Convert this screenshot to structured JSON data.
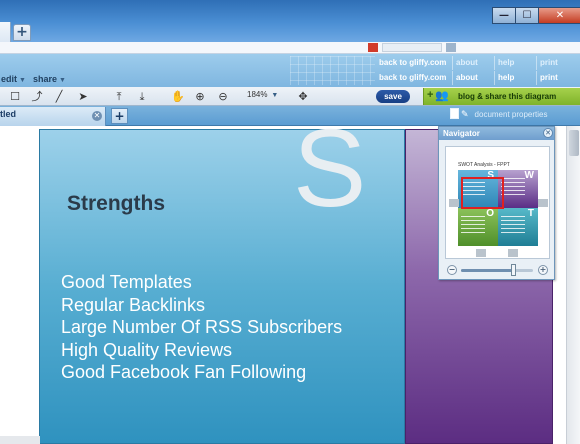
{
  "browser": {
    "new_tab": "+",
    "window_controls": {
      "minimize": "—",
      "maximize": "☐",
      "close": "✕"
    }
  },
  "header": {
    "menu": [
      {
        "label": "edit"
      },
      {
        "label": "share"
      }
    ],
    "links_top": [
      "back to gliffy.com",
      "about",
      "help",
      "print"
    ],
    "links_bottom": [
      "back to gliffy.com",
      "about",
      "help",
      "print"
    ]
  },
  "toolbar": {
    "tools": [
      "select-icon",
      "connector-icon",
      "line-icon",
      "pointer-icon",
      "bring-front-icon",
      "send-back-icon",
      "hand-icon",
      "zoom-in-icon",
      "zoom-out-icon",
      "fit-icon"
    ],
    "zoom_level": "184%",
    "save_label": "save",
    "blog_share_label": "blog & share this diagram",
    "blog_share_icon": "add-people-icon",
    "blog_accent": "#8dbf37"
  },
  "tabs": {
    "current": "tled",
    "add": "+",
    "document_properties": "document properties"
  },
  "diagram": {
    "strengths_letter": "S",
    "strengths_heading": "Strengths",
    "strengths_items": [
      "Good Templates",
      "Regular Backlinks",
      "Large Number Of RSS Subscribers",
      "High Quality Reviews",
      "Good Facebook Fan Following"
    ],
    "strengths_color": "#3a9bc6",
    "weaknesses_color": "#6c3f92"
  },
  "navigator": {
    "title": "Navigator",
    "close": "✕",
    "mini_title": "SWOT Analysis - FPPT",
    "quadrants": [
      "S",
      "W",
      "O",
      "T"
    ],
    "zoom_minus": "−",
    "zoom_plus": "+",
    "zoom_fraction": 0.75
  }
}
